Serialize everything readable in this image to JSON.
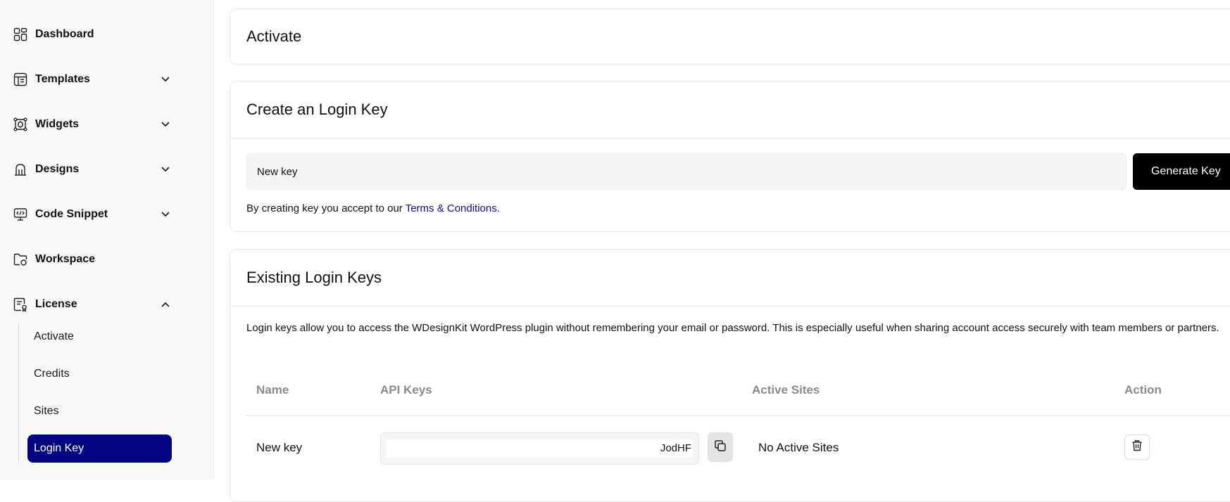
{
  "sidebar": {
    "items": [
      {
        "label": "Dashboard",
        "icon": "dashboard-icon"
      },
      {
        "label": "Templates",
        "icon": "templates-icon"
      },
      {
        "label": "Widgets",
        "icon": "widgets-icon"
      },
      {
        "label": "Designs",
        "icon": "designs-icon"
      },
      {
        "label": "Code Snippet",
        "icon": "code-snippet-icon"
      },
      {
        "label": "Workspace",
        "icon": "workspace-icon"
      },
      {
        "label": "License",
        "icon": "license-icon"
      }
    ],
    "license_sub": [
      "Activate",
      "Credits",
      "Sites",
      "Login Key"
    ],
    "active_sub": "Login Key"
  },
  "activate_card": {
    "title": "Activate"
  },
  "create_card": {
    "title": "Create an Login Key",
    "input_value": "New key",
    "generate_label": "Generate Key",
    "terms_text": "By creating key you accept to our ",
    "terms_link": "Terms & Conditions."
  },
  "existing_card": {
    "title": "Existing Login Keys",
    "description": "Login keys allow you to access the WDesignKit WordPress plugin without remembering your email or password. This is especially useful when sharing account access securely with team members or partners.",
    "headers": [
      "Name",
      "API Keys",
      "Active Sites",
      "Action"
    ],
    "rows": [
      {
        "name": "New key",
        "api_key": "JodHF",
        "active_sites": "No Active Sites"
      }
    ]
  },
  "colors": {
    "accent": "#040483",
    "link": "#0b0b8c"
  }
}
